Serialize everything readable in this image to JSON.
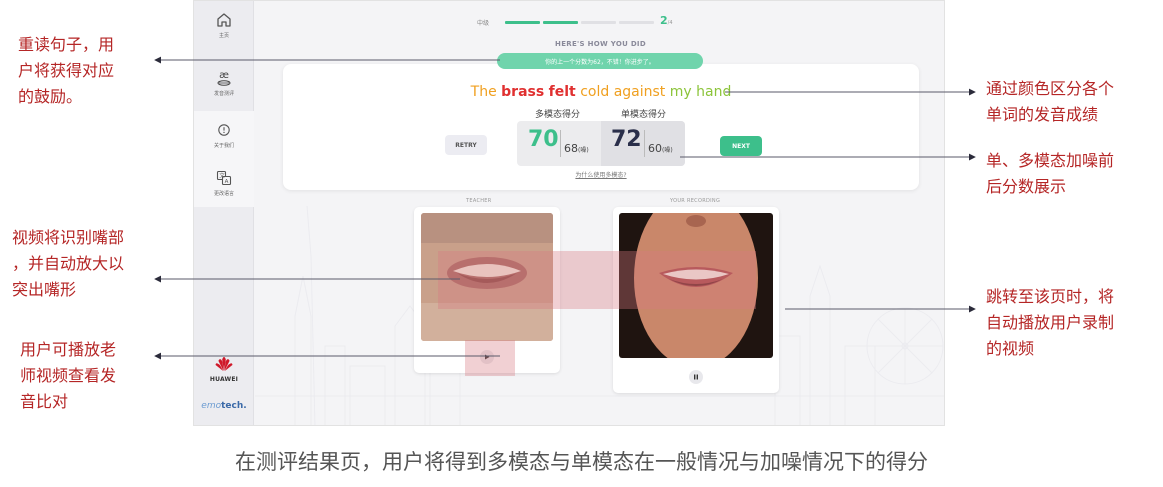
{
  "sidebar": {
    "items": [
      {
        "label": "主页",
        "icon": "home-icon"
      },
      {
        "label": "发音测评",
        "icon": "phonetic-icon",
        "glyph": "æ"
      },
      {
        "label": "关于我们",
        "icon": "info-chat-icon"
      },
      {
        "label": "更改语言",
        "icon": "translate-icon"
      }
    ],
    "brand_huawei": "HUAWEI",
    "brand_emotech_em": "emo",
    "brand_emotech_tech": "tech."
  },
  "progress": {
    "level": "中级",
    "current": "2",
    "total": "/4",
    "completed_segments": 2,
    "total_segments": 4
  },
  "heading": "HERE'S HOW YOU DID",
  "encouragement": "你的上一个分数为62，不错！你进步了。",
  "sentence": [
    {
      "word": "The",
      "color": "#f0a020"
    },
    {
      "word": "brass",
      "color": "#e03030"
    },
    {
      "word": "felt",
      "color": "#e03030"
    },
    {
      "word": "cold",
      "color": "#f0a020"
    },
    {
      "word": "against",
      "color": "#f0a020"
    },
    {
      "word": "my",
      "color": "#8cc43a"
    },
    {
      "word": "hand",
      "color": "#8cc43a"
    }
  ],
  "scores": {
    "multimodal_title": "多模态得分",
    "unimodal_title": "单模态得分",
    "multimodal_clean": "70",
    "multimodal_noisy": "68",
    "unimodal_clean": "72",
    "unimodal_noisy": "60",
    "noise_suffix": "(噪)",
    "multimodal_color": "#3dbf8b",
    "unimodal_color": "#2a2f4a"
  },
  "buttons": {
    "retry": "RETRY",
    "next": "NEXT"
  },
  "why_link": "为什么使用多模态?",
  "videos": {
    "teacher_label": "TEACHER",
    "recording_label": "YOUR RECORDING"
  },
  "annotations": {
    "reread": [
      "重读句子，用",
      "户将获得对应",
      "的鼓励。"
    ],
    "zoom": [
      "视频将识别嘴部",
      "，并自动放大以",
      "突出嘴形"
    ],
    "play_teacher": [
      "用户可播放老",
      "师视频查看发",
      "音比对"
    ],
    "word_colors": [
      "通过颜色区分各个",
      "单词的发音成绩"
    ],
    "scores_display": [
      "单、多模态加噪前",
      "后分数展示"
    ],
    "autoplay": [
      "跳转至该页时，将",
      "自动播放用户录制",
      "的视频"
    ]
  },
  "caption": "在测评结果页，用户将得到多模态与单模态在一般情况与加噪情况下的得分"
}
